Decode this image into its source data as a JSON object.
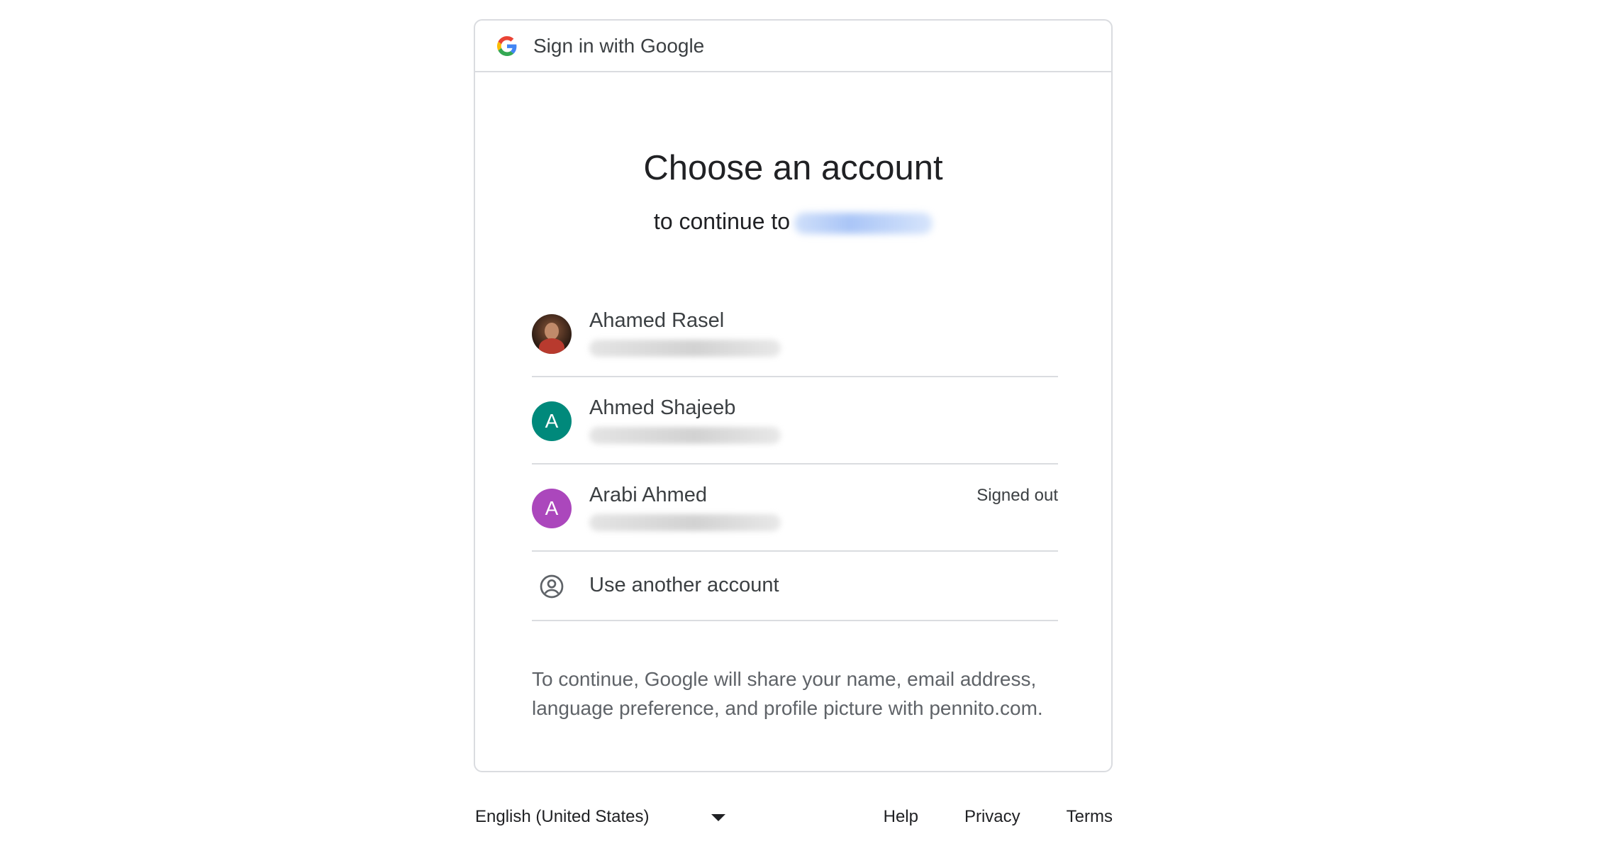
{
  "header": {
    "title": "Sign in with Google",
    "logo_icon": "google-g-icon"
  },
  "main": {
    "title": "Choose an account",
    "subtitle_prefix": "to continue to"
  },
  "accounts": [
    {
      "name": "Ahamed Rasel",
      "avatar_type": "photo",
      "status": ""
    },
    {
      "name": "Ahmed Shajeeb",
      "avatar_letter": "A",
      "avatar_color": "#00897b",
      "status": ""
    },
    {
      "name": "Arabi Ahmed",
      "avatar_letter": "A",
      "avatar_color": "#ab47bc",
      "status": "Signed out"
    }
  ],
  "use_another": {
    "label": "Use another account",
    "icon": "account-circle-icon"
  },
  "disclaimer": {
    "line1": "To continue, Google will share your name, email address,",
    "line2": "language preference, and profile picture with pennito.com."
  },
  "footer": {
    "language": "English (United States)",
    "links": [
      "Help",
      "Privacy",
      "Terms"
    ]
  },
  "colors": {
    "border": "#dadce0",
    "text_primary": "#202124",
    "text_secondary": "#5f6368"
  }
}
